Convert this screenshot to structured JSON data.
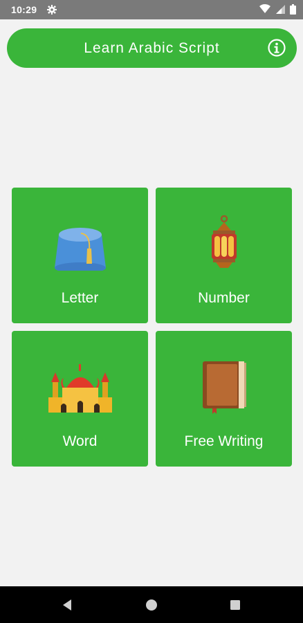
{
  "status_bar": {
    "time": "10:29",
    "icons": [
      "settings-gear-icon",
      "wifi-icon",
      "cellular-signal-icon",
      "battery-icon"
    ]
  },
  "app_bar": {
    "title": "Learn Arabic Script",
    "info_icon": "info-icon",
    "color": "#3ab53a"
  },
  "tiles": [
    {
      "label": "Letter",
      "icon": "fez-hat-icon"
    },
    {
      "label": "Number",
      "icon": "lantern-icon"
    },
    {
      "label": "Word",
      "icon": "mosque-icon"
    },
    {
      "label": "Free Writing",
      "icon": "book-icon"
    }
  ],
  "nav_bar": {
    "buttons": [
      "back-triangle-icon",
      "home-circle-icon",
      "recents-square-icon"
    ]
  }
}
